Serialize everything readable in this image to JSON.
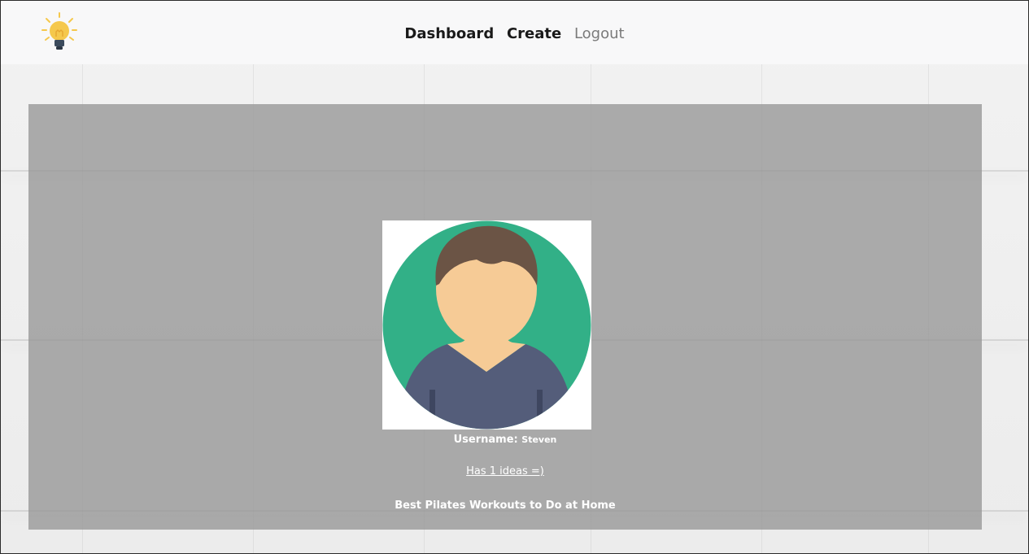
{
  "nav": {
    "logo_icon": "lightbulb-icon",
    "dashboard_label": "Dashboard",
    "create_label": "Create",
    "logout_label": "Logout"
  },
  "profile": {
    "avatar_icon": "user-avatar-icon",
    "username_label": "Username:",
    "username_value": "Steven",
    "ideas_count_text": "Has 1 ideas =)",
    "ideas": [
      {
        "title": "Best Pilates Workouts to Do at Home"
      }
    ]
  },
  "colors": {
    "avatar_bg": "#32b087",
    "hair": "#6b5445",
    "skin": "#f6cb96",
    "shirt": "#545d7a",
    "bulb": "#f5c84c"
  }
}
